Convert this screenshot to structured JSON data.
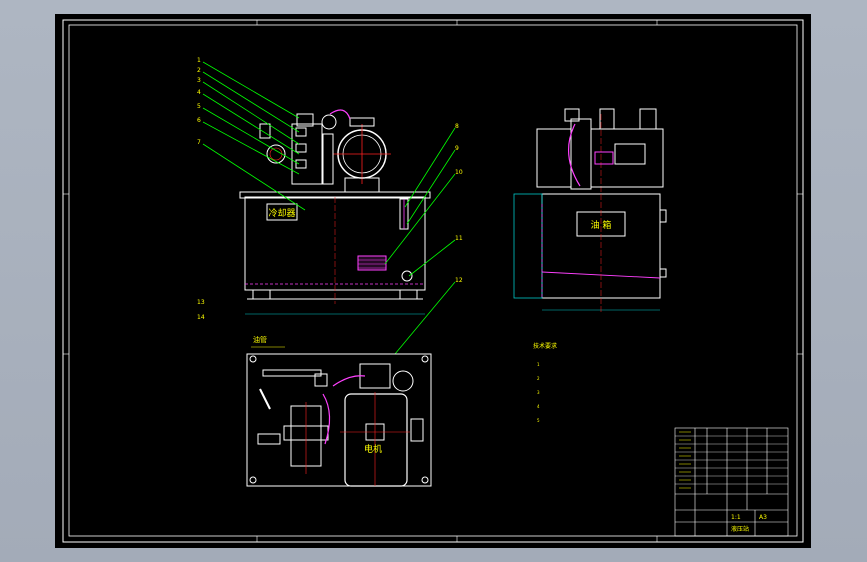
{
  "drawing": {
    "labels": {
      "cooler": "冷却器",
      "oil_tank": "油  箱",
      "motor": "电机",
      "oil_pipe": "油管"
    },
    "part_numbers_left": [
      "1",
      "2",
      "3",
      "4",
      "5",
      "6",
      "7"
    ],
    "part_numbers_right": [
      "8",
      "9",
      "10",
      "11",
      "12"
    ],
    "part_numbers_plan": [
      "13",
      "14"
    ],
    "notes": {
      "title": "技术要求",
      "items": [
        "1",
        "2",
        "3",
        "4",
        "5"
      ]
    },
    "title_block": {
      "scale": "1:1",
      "drawing_name": "液压站",
      "company": "A3"
    }
  },
  "colors": {
    "background": "#000000",
    "frame": "#ffffff",
    "leader": "#00ff00",
    "centerline": "#ff2020",
    "hidden": "#ff40ff",
    "annotation": "#ffff00",
    "dimension": "#00c8c8"
  }
}
